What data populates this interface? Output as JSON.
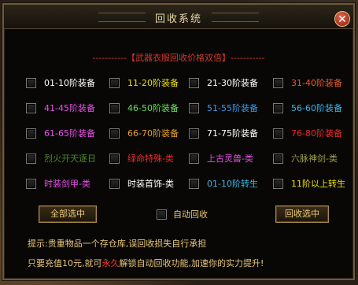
{
  "window": {
    "title": "回收系统",
    "close_symbol": "✕"
  },
  "header_text": "-----------【武器衣服回收价格双倍】-----------",
  "colors": {
    "white": "#ffffff",
    "yellow": "#e8d000",
    "green": "#3ad04a",
    "light_green": "#7ae06a",
    "cyan": "#3ab8e8",
    "red": "#e83a2a",
    "pink": "#e83a8a",
    "orange": "#e8a02a",
    "magenta": "#d85ae8",
    "purple": "#a06ae8",
    "gold": "#e8c87a",
    "olive": "#6a9a3a",
    "dark_red": "#e82a2a"
  },
  "rows": [
    [
      {
        "label": "01-10阶装备",
        "color": "#ffffff"
      },
      {
        "label": "11-20阶装备",
        "color": "#e8e000"
      },
      {
        "label": "21-30阶装备",
        "color": "#ffffff"
      },
      {
        "label": "31-40阶装备",
        "color": "#e85a2a"
      }
    ],
    [
      {
        "label": "41-45阶装备",
        "color": "#e850e8"
      },
      {
        "label": "46-50阶装备",
        "color": "#6ae05a"
      },
      {
        "label": "51-55阶装备",
        "color": "#3a9ae8"
      },
      {
        "label": "56-60阶装备",
        "color": "#3ab8e8"
      }
    ],
    [
      {
        "label": "61-65阶装备",
        "color": "#e850e8"
      },
      {
        "label": "66-70阶装备",
        "color": "#e8a02a"
      },
      {
        "label": "71-75阶装备",
        "color": "#ffffff"
      },
      {
        "label": "76-80阶装备",
        "color": "#e82a2a"
      }
    ],
    [
      {
        "label": "烈火开天逐日",
        "color": "#4a8a2a"
      },
      {
        "label": "绿命特殊-类",
        "color": "#e82a2a"
      },
      {
        "label": "上古灵兽-类",
        "color": "#e850e8"
      },
      {
        "label": "六脉神剑-类",
        "color": "#a0a04a"
      }
    ],
    [
      {
        "label": "时装剑甲-类",
        "color": "#e850e8"
      },
      {
        "label": "时装首饰-类",
        "color": "#ffffff"
      },
      {
        "label": "01-10阶转生",
        "color": "#3ab8e8"
      },
      {
        "label": "11阶以上转生",
        "color": "#e8e000"
      }
    ]
  ],
  "buttons": {
    "select_all": "全部选中",
    "auto_recycle": "自动回收",
    "recycle_selected": "回收选中"
  },
  "tips": {
    "line1": "提示:贵重物品一个存仓库,误回收损失自行承担",
    "line2_before": "只要充值10元,就可",
    "line2_red": "永久",
    "line2_after": "解锁自动回收功能,加速你的实力提升!"
  }
}
